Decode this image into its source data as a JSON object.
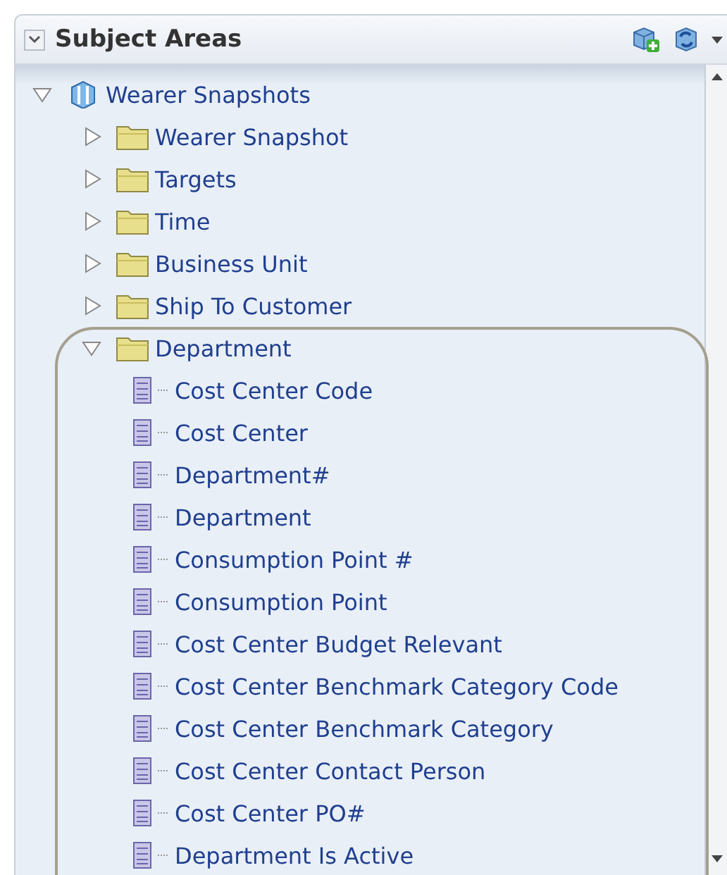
{
  "panel": {
    "title": "Subject Areas"
  },
  "tree": [
    {
      "label": "Wearer Snapshots",
      "kind": "subject-area",
      "expanded": true,
      "children": [
        {
          "label": "Wearer Snapshot",
          "kind": "folder",
          "expanded": false
        },
        {
          "label": "Targets",
          "kind": "folder",
          "expanded": false
        },
        {
          "label": "Time",
          "kind": "folder",
          "expanded": false
        },
        {
          "label": "Business Unit",
          "kind": "folder",
          "expanded": false
        },
        {
          "label": "Ship To Customer",
          "kind": "folder",
          "expanded": false
        },
        {
          "label": "Department",
          "kind": "folder",
          "expanded": true,
          "children": [
            {
              "label": "Cost Center Code",
              "kind": "column"
            },
            {
              "label": "Cost Center",
              "kind": "column"
            },
            {
              "label": "Department#",
              "kind": "column"
            },
            {
              "label": "Department",
              "kind": "column"
            },
            {
              "label": "Consumption Point #",
              "kind": "column"
            },
            {
              "label": "Consumption Point",
              "kind": "column"
            },
            {
              "label": "Cost Center Budget Relevant",
              "kind": "column"
            },
            {
              "label": "Cost Center Benchmark Category Code",
              "kind": "column"
            },
            {
              "label": "Cost Center Benchmark Category",
              "kind": "column"
            },
            {
              "label": "Cost Center Contact Person",
              "kind": "column"
            },
            {
              "label": "Cost Center PO#",
              "kind": "column"
            },
            {
              "label": "Department Is Active",
              "kind": "column"
            }
          ]
        }
      ]
    }
  ]
}
